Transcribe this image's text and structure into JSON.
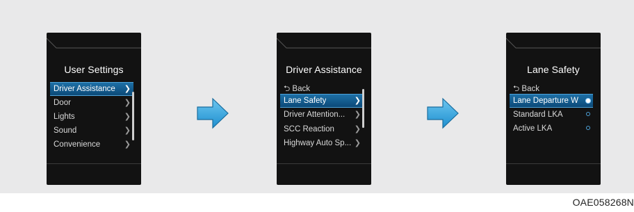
{
  "screens": [
    {
      "title": "User Settings",
      "items": [
        {
          "label": "Driver Assistance",
          "selected": true
        },
        {
          "label": "Door",
          "selected": false
        },
        {
          "label": "Lights",
          "selected": false
        },
        {
          "label": "Sound",
          "selected": false
        },
        {
          "label": "Convenience",
          "selected": false
        }
      ]
    },
    {
      "title": "Driver Assistance",
      "back": "Back",
      "items": [
        {
          "label": "Lane Safety",
          "selected": true
        },
        {
          "label": "Driver Attention...",
          "selected": false
        },
        {
          "label": "SCC Reaction",
          "selected": false
        },
        {
          "label": "Highway Auto Sp...",
          "selected": false
        }
      ]
    },
    {
      "title": "Lane Safety",
      "back": "Back",
      "items": [
        {
          "label": "Lane Departure W",
          "selected": true
        },
        {
          "label": "Standard LKA",
          "selected": false
        },
        {
          "label": "Active LKA",
          "selected": false
        }
      ]
    }
  ],
  "caption": "OAE058268N",
  "colors": {
    "accent": "#1d6fa6",
    "arrow": "#3aa8df",
    "background": "#e9e9ea"
  },
  "icons": {
    "chevron": "chevron-right-icon",
    "back": "back-arrow-icon",
    "radio": "radio-button-icon",
    "flow": "right-arrow-icon"
  }
}
